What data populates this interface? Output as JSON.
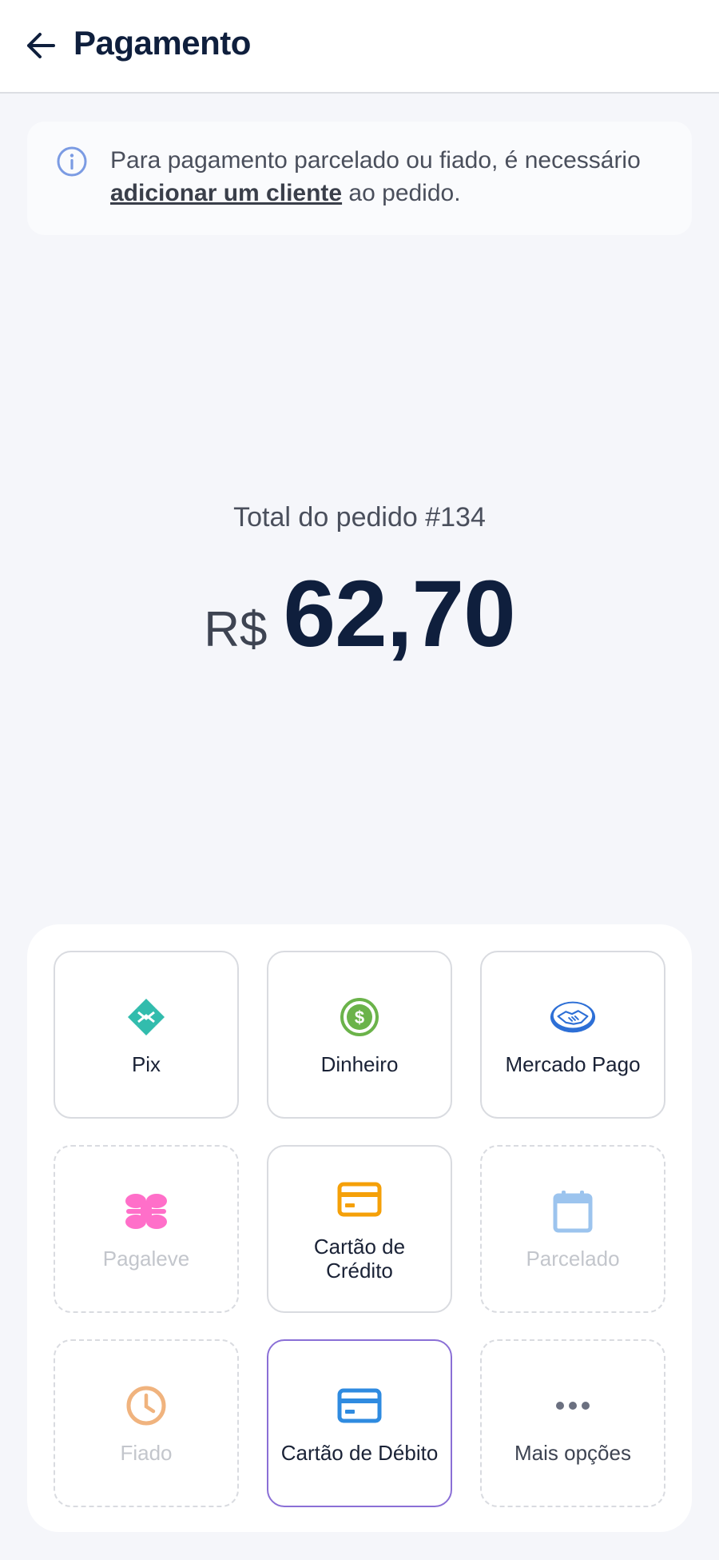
{
  "header": {
    "title": "Pagamento"
  },
  "banner": {
    "text_before": "Para pagamento parcelado ou fiado, é necessário ",
    "link": "adicionar um cliente",
    "text_after": " ao pedido."
  },
  "order": {
    "label": "Total do pedido #134",
    "currency": "R$",
    "amount": "62,70"
  },
  "methods": [
    {
      "label": "Pix",
      "icon": "pix-icon",
      "enabled": true
    },
    {
      "label": "Dinheiro",
      "icon": "dollar-coin-icon",
      "enabled": true
    },
    {
      "label": "Mercado Pago",
      "icon": "handshake-icon",
      "enabled": true
    },
    {
      "label": "Pagaleve",
      "icon": "pagaleve-icon",
      "enabled": false
    },
    {
      "label": "Cartão de Crédito",
      "icon": "credit-card-icon",
      "enabled": true
    },
    {
      "label": "Parcelado",
      "icon": "calendar-icon",
      "enabled": false
    },
    {
      "label": "Fiado",
      "icon": "clock-icon",
      "enabled": false
    },
    {
      "label": "Cartão de Débito",
      "icon": "debit-card-icon",
      "enabled": true,
      "selected": true
    },
    {
      "label": "Mais opções",
      "icon": "more-dots-icon",
      "enabled": true
    }
  ],
  "colors": {
    "pix": "#32bcad",
    "cash": "#6bb34a",
    "mercado_pago": "#2d6fd6",
    "pagaleve": "#ff6fc9",
    "credit_card": "#f5a008",
    "calendar": "#9cc4ee",
    "clock": "#f0b37e",
    "debit_card": "#2f8be0",
    "selected_border": "#8a6fd6"
  }
}
